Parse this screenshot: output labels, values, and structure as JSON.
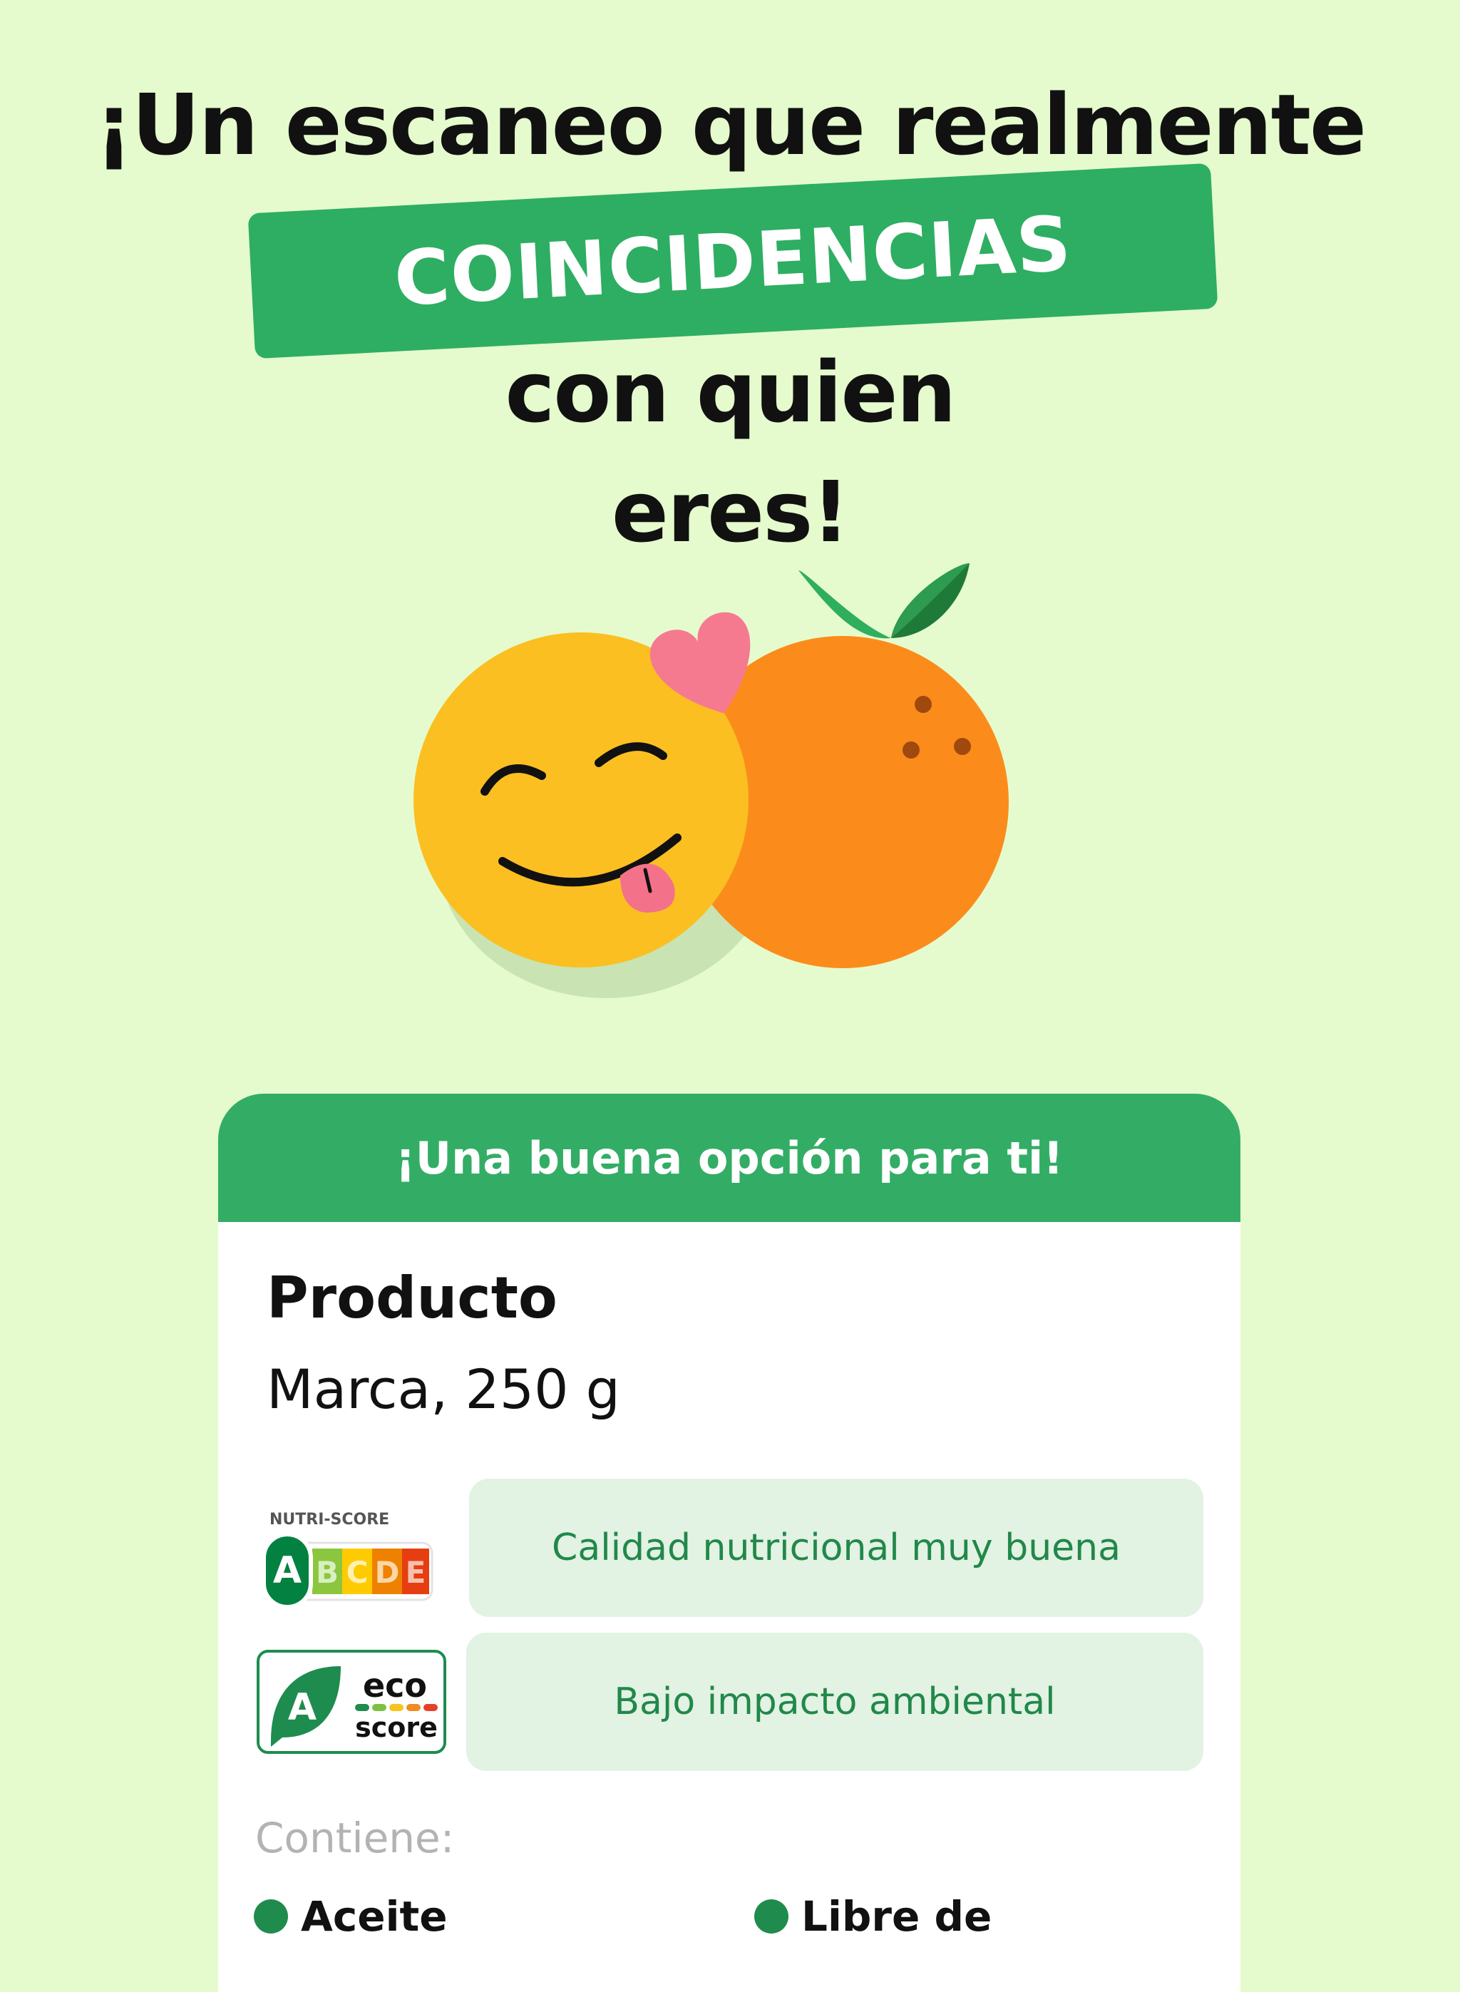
{
  "headline": {
    "line1": "¡Un escaneo que realmente",
    "highlight": "COINCIDENCIAS",
    "line3": "con quien",
    "line4": "eres!"
  },
  "card": {
    "header": "¡Una buena opción para ti!",
    "product_name": "Producto",
    "product_sub": "Marca, 250 g",
    "nutri_score": {
      "label": "NUTRI-SCORE",
      "grades": [
        "A",
        "B",
        "C",
        "D",
        "E"
      ],
      "selected": "A",
      "description": "Calidad nutricional muy buena"
    },
    "eco_score": {
      "grade": "A",
      "word1": "eco",
      "word2": "score",
      "description": "Bajo impacto ambiental"
    },
    "contains_label": "Contiene:",
    "tags": [
      "Aceite",
      "Libre de"
    ]
  },
  "colors": {
    "background": "#e5fbcd",
    "accent_green": "#2eae62",
    "pill_bg": "#e2f2e3",
    "pill_text": "#21884a"
  },
  "icons": [
    "smiley-face-icon",
    "orange-fruit-icon",
    "heart-icon",
    "nutri-score-badge",
    "eco-score-badge"
  ]
}
